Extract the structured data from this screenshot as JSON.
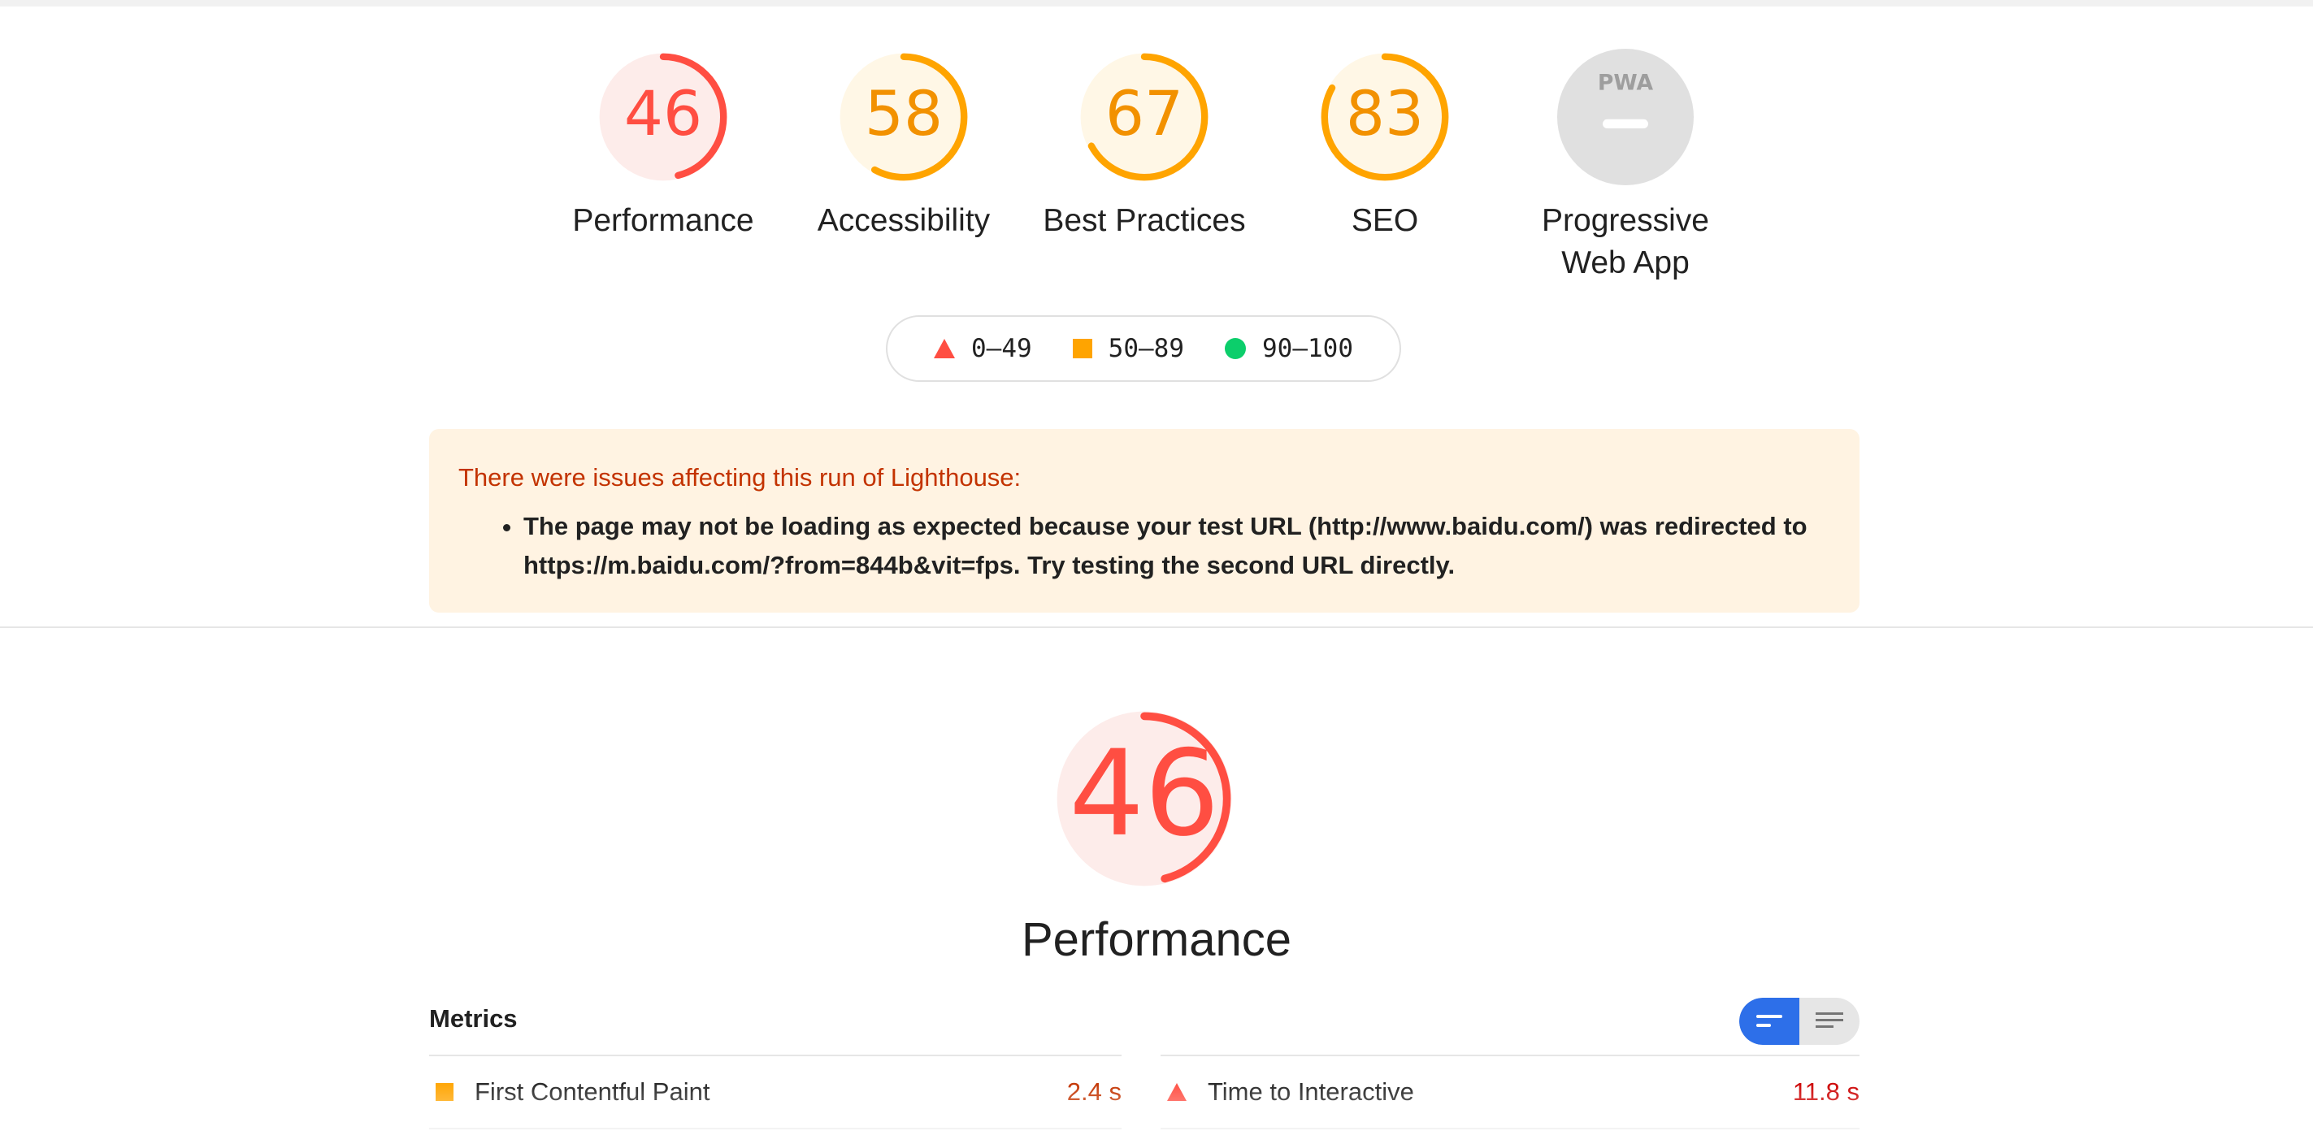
{
  "gauges": [
    {
      "score": "46",
      "label": "Performance",
      "color": "#ff4e42",
      "bg": "#fdecea",
      "fraction": 0.46
    },
    {
      "score": "58",
      "label": "Accessibility",
      "color": "#ffa400",
      "bg": "#fff7e6",
      "fraction": 0.58
    },
    {
      "score": "67",
      "label": "Best Practices",
      "color": "#ffa400",
      "bg": "#fff7e6",
      "fraction": 0.67
    },
    {
      "score": "83",
      "label": "SEO",
      "color": "#ffa400",
      "bg": "#fff7e6",
      "fraction": 0.83
    },
    {
      "score": "",
      "label": "Progressive Web App",
      "icon": "pwa-icon",
      "color": "#9e9e9e",
      "bg": "#e0e0e0"
    }
  ],
  "legend": [
    {
      "range": "0–49",
      "shape": "triangle",
      "color": "#ff4e42"
    },
    {
      "range": "50–89",
      "shape": "square",
      "color": "#ffa400"
    },
    {
      "range": "90–100",
      "shape": "circle",
      "color": "#0cce6b"
    }
  ],
  "warning": {
    "title": "There were issues affecting this run of Lighthouse:",
    "items": [
      "The page may not be loading as expected because your test URL (http://www.baidu.com/) was redirected to https://m.baidu.com/?from=844b&vit=fps. Try testing the second URL directly."
    ]
  },
  "performance": {
    "score": "46",
    "fraction": 0.46,
    "title": "Performance",
    "color": "#ff4e42",
    "bg": "#fdecea"
  },
  "metrics": {
    "heading": "Metrics",
    "toggle": {
      "active": "bar-view",
      "icons": [
        "bar-view-icon",
        "list-view-icon"
      ]
    },
    "items": [
      {
        "label": "First Contentful Paint",
        "value": "2.4 s",
        "rating": "average",
        "color": "#c33300",
        "icon": "square-icon"
      },
      {
        "label": "Time to Interactive",
        "value": "11.8 s",
        "rating": "fail",
        "color": "#cc0000",
        "icon": "triangle-icon"
      }
    ]
  }
}
